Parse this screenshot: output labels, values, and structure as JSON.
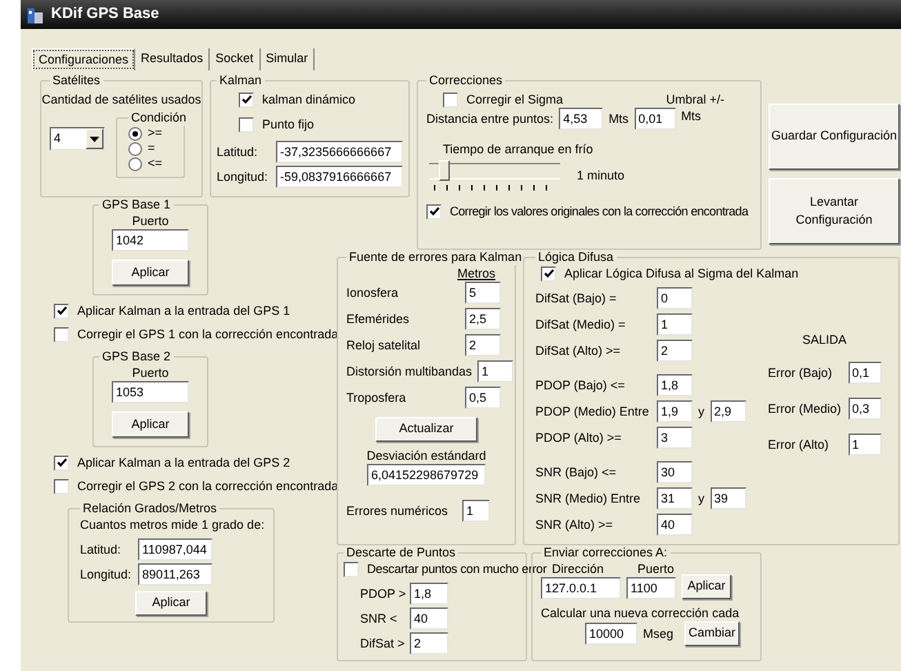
{
  "window": {
    "title": "KDif GPS Base"
  },
  "tabs": [
    {
      "label": "Configuraciones",
      "selected": true
    },
    {
      "label": "Resultados",
      "selected": false
    },
    {
      "label": "Socket",
      "selected": false
    },
    {
      "label": "Simular",
      "selected": false
    }
  ],
  "satelites": {
    "title": "Satélites",
    "label": "Cantidad de satélites usados",
    "count": "4",
    "condicion": {
      "title": "Condición",
      "options": [
        {
          "label": ">=",
          "selected": true
        },
        {
          "label": "=",
          "selected": false
        },
        {
          "label": "<=",
          "selected": false
        }
      ]
    }
  },
  "kalman": {
    "title": "Kalman",
    "checks": [
      {
        "label": "kalman dinámico",
        "checked": true
      },
      {
        "label": "Punto fijo",
        "checked": false
      }
    ],
    "fields": [
      {
        "label": "Latitud:",
        "value": "-37,3235666666667"
      },
      {
        "label": "Longitud:",
        "value": "-59,0837916666667"
      }
    ]
  },
  "correcciones": {
    "title": "Correcciones",
    "corregir_sigma": {
      "label": "Corregir el Sigma",
      "checked": false
    },
    "distancia_label": "Distancia entre puntos:",
    "distancia": "4,53",
    "unit1": "Mts",
    "umbral_label": "Umbral +/-",
    "umbral": "0,01",
    "unit2": "Mts",
    "tiempo_label": "Tiempo de arranque en frío",
    "slider": {
      "level": 0.08
    },
    "slider_reading": "1 minuto",
    "corregir_valores": {
      "label": "Corregir los valores originales con la corrección encontrada",
      "checked": true
    }
  },
  "buttons": [
    "Guardar Configuración",
    "Levantar Configuración"
  ],
  "gps_bases": [
    {
      "title": "GPS Base 1",
      "port_label": "Puerto",
      "port": "1042",
      "button": "Aplicar",
      "checks": [
        {
          "label": "Aplicar Kalman a la entrada del GPS 1",
          "checked": true
        },
        {
          "label": "Corregir el GPS 1 con la corrección encontrada",
          "checked": false
        }
      ]
    },
    {
      "title": "GPS Base 2",
      "port_label": "Puerto",
      "port": "1053",
      "button": "Aplicar",
      "checks": [
        {
          "label": "Aplicar Kalman a la entrada del GPS 2",
          "checked": true
        },
        {
          "label": "Corregir el GPS 2 con la corrección encontrada",
          "checked": false
        }
      ]
    }
  ],
  "relacion": {
    "title": "Relación Grados/Metros",
    "label": "Cuantos metros mide 1 grado de:",
    "fields": [
      {
        "label": "Latitud:",
        "value": "110987,044"
      },
      {
        "label": "Longitud:",
        "value": "89011,263"
      }
    ],
    "button": "Aplicar"
  },
  "fuente": {
    "title": "Fuente de errores para Kalman",
    "column": "Metros",
    "rows": [
      {
        "label": "Ionosfera",
        "value": "5"
      },
      {
        "label": "Efemérides",
        "value": "2,5"
      },
      {
        "label": "Reloj satelital",
        "value": "2"
      },
      {
        "label": "Distorsión multibandas",
        "value": "1"
      },
      {
        "label": "Troposfera",
        "value": "0,5"
      }
    ],
    "button": "Actualizar",
    "desv_label": "Desviación estándard",
    "desv": "6,04152298679729",
    "errores_label": "Errores numéricos",
    "errores": "1"
  },
  "descarte": {
    "title": "Descarte de Puntos",
    "check": {
      "label": "Descartar puntos con mucho error",
      "checked": false
    },
    "fields": [
      {
        "label": "PDOP >",
        "value": "1,8"
      },
      {
        "label": "SNR <",
        "value": "40"
      },
      {
        "label": "DifSat >",
        "value": "2"
      }
    ]
  },
  "logica": {
    "title": "Lógica Difusa",
    "check": {
      "label": "Aplicar Lógica Difusa al Sigma del Kalman",
      "checked": true
    },
    "groups": [
      [
        {
          "label": "DifSat (Bajo) =",
          "values": [
            "0"
          ]
        },
        {
          "label": "DifSat (Medio) =",
          "values": [
            "1"
          ]
        },
        {
          "label": "DifSat (Alto) >=",
          "values": [
            "2"
          ]
        }
      ],
      [
        {
          "label": "PDOP (Bajo) <=",
          "values": [
            "1,8"
          ]
        },
        {
          "label": "PDOP (Medio) Entre",
          "values": [
            "1,9",
            "2,9"
          ],
          "joiner": "y"
        },
        {
          "label": "PDOP (Alto) >=",
          "values": [
            "3"
          ]
        }
      ],
      [
        {
          "label": "SNR (Bajo) <=",
          "values": [
            "30"
          ]
        },
        {
          "label": "SNR (Medio) Entre",
          "values": [
            "31",
            "39"
          ],
          "joiner": "y"
        },
        {
          "label": "SNR (Alto) >=",
          "values": [
            "40"
          ]
        }
      ]
    ],
    "salida": {
      "title": "SALIDA",
      "rows": [
        {
          "label": "Error (Bajo)",
          "value": "0,1"
        },
        {
          "label": "Error (Medio)",
          "value": "0,3"
        },
        {
          "label": "Error (Alto)",
          "value": "1"
        }
      ]
    }
  },
  "enviar": {
    "title": "Enviar correcciones A:",
    "dir_label": "Dirección",
    "dir": "127.0.0.1",
    "port_label": "Puerto",
    "port": "1100",
    "button": "Aplicar",
    "calc_label": "Calcular una nueva corrección cada",
    "interval": "10000",
    "unit": "Mseg",
    "button2": "Cambiar"
  }
}
